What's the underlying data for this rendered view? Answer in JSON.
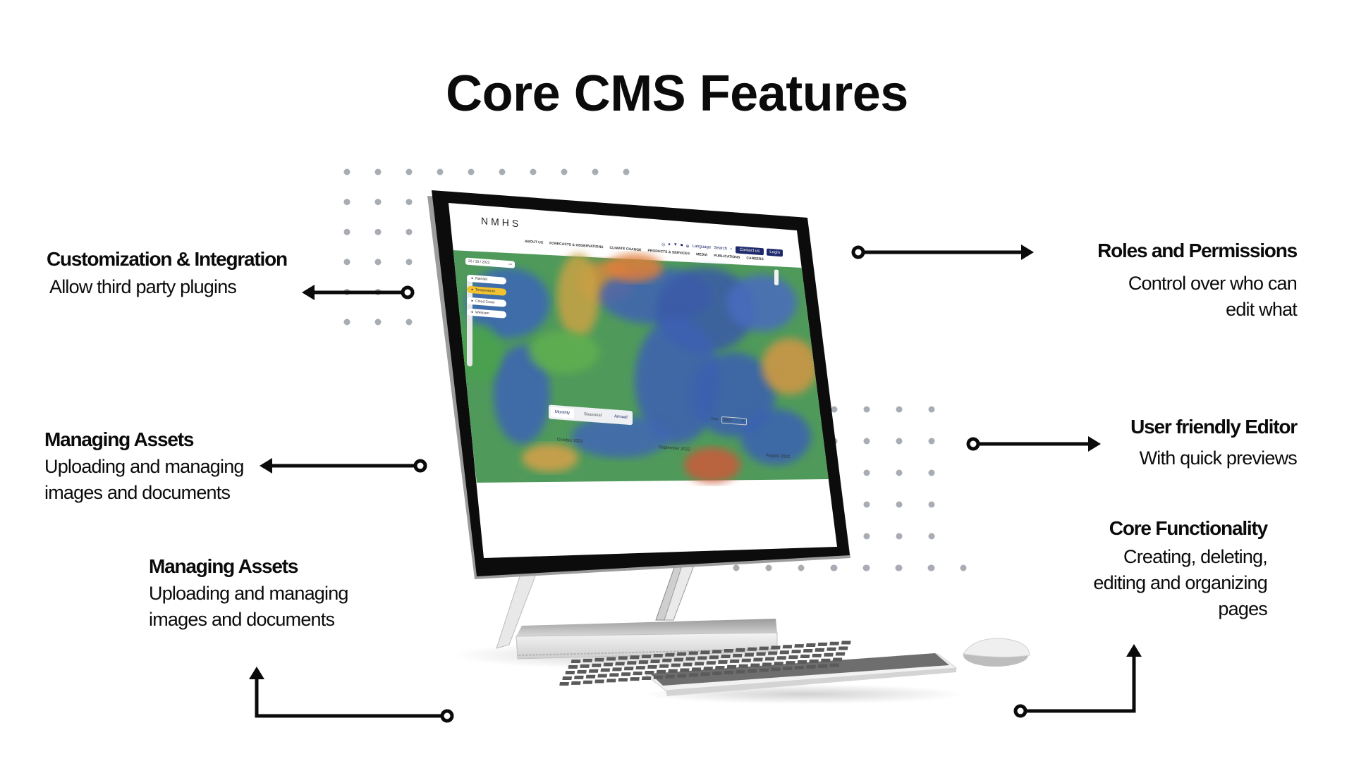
{
  "slide": {
    "title": "Core CMS Features"
  },
  "features": [
    {
      "id": "customization",
      "heading": "Customization & Integration",
      "lines": [
        "Allow third party plugins"
      ]
    },
    {
      "id": "roles",
      "heading": "Roles and Permissions",
      "lines": [
        "Control over who can",
        "edit what"
      ]
    },
    {
      "id": "assets-1",
      "heading": "Managing Assets",
      "lines": [
        "Uploading and managing",
        "images  and documents"
      ]
    },
    {
      "id": "editor",
      "heading": "User friendly Editor",
      "lines": [
        "With quick previews"
      ]
    },
    {
      "id": "assets-2",
      "heading": "Managing Assets",
      "lines": [
        "Uploading and managing",
        "images  and documents"
      ]
    },
    {
      "id": "core",
      "heading": "Core Functionality",
      "lines": [
        "Creating, deleting,",
        "editing and organizing",
        "pages"
      ]
    }
  ],
  "screen": {
    "logo": "NMHS",
    "social_icons": [
      "instagram-icon",
      "facebook-icon",
      "twitter-icon",
      "youtube-icon"
    ],
    "language_label": "Language",
    "search_label": "Search",
    "contact_button": "Contact us",
    "login_button": "Login",
    "nav": [
      "ABOUT US",
      "FORECASTS & OBSERVATIONS",
      "CLIMATE CHANGE",
      "PRODUCTS & SERVICES",
      "MEDIA",
      "PUBLICATIONS",
      "CAREERS"
    ],
    "date_value": "22 / 10 / 2022",
    "layers": [
      {
        "label": "Rainfall",
        "icon": "rain-icon",
        "active": false
      },
      {
        "label": "Temperature",
        "icon": "thermometer-icon",
        "active": true
      },
      {
        "label": "Cloud Cover",
        "icon": "cloud-icon",
        "active": false
      },
      {
        "label": "Webcam",
        "icon": "camera-icon",
        "active": false
      }
    ],
    "tabs": [
      {
        "label": "Monthly",
        "active": true
      },
      {
        "label": "Seasonal",
        "active": false
      },
      {
        "label": "Annual",
        "active": false
      }
    ],
    "year_label": "Year:",
    "year_value": "2022",
    "months": [
      "October 2022",
      "September 2022",
      "August 2022"
    ],
    "colors": {
      "nav_button": "#1f2a6b",
      "active_layer": "#f2c230",
      "map_green": "#4aa64a",
      "map_blue": "#3a5fb5"
    }
  }
}
